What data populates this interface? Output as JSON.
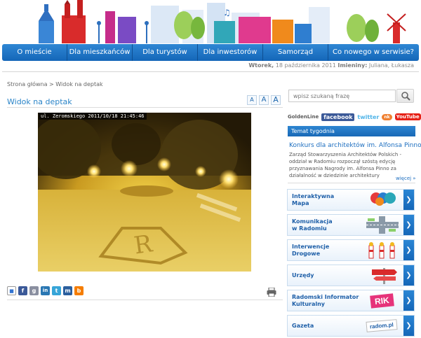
{
  "nav": {
    "items": [
      {
        "label": "O mieście"
      },
      {
        "label": "Dla mieszkańców"
      },
      {
        "label": "Dla turystów"
      },
      {
        "label": "Dla inwestorów"
      },
      {
        "label": "Samorząd"
      },
      {
        "label": "Co nowego w serwisie?"
      }
    ]
  },
  "dateline": {
    "day": "Wtorek,",
    "date": "18 października 2011",
    "names_label": "Imieniny:",
    "names": "Juliana, Łukasza"
  },
  "breadcrumb": {
    "home": "Strona główna",
    "separator": ">",
    "current": "Widok na deptak"
  },
  "page": {
    "title": "Widok na deptak"
  },
  "font_size_buttons": [
    "A",
    "A",
    "A"
  ],
  "webcam": {
    "stamp": "ul. Zeromskiego 2011/10/18 21:45:46"
  },
  "share_icons": [
    {
      "icon": "delicious-icon",
      "glyph": "■",
      "color": "#3274d1"
    },
    {
      "icon": "facebook-icon",
      "glyph": "f",
      "color": "#3b5998"
    },
    {
      "icon": "google-icon",
      "glyph": "g",
      "color": "#8a8fa0"
    },
    {
      "icon": "linkedin-icon",
      "glyph": "in",
      "color": "#2a77b3"
    },
    {
      "icon": "twitter-icon",
      "glyph": "t",
      "color": "#37a5d8"
    },
    {
      "icon": "myspace-icon",
      "glyph": "m",
      "color": "#2b5f9e"
    },
    {
      "icon": "blogger-icon",
      "glyph": "b",
      "color": "#f57d00"
    }
  ],
  "search": {
    "placeholder": "wpisz szukaną frazę"
  },
  "socials": {
    "golden": "GoldenLine",
    "facebook": "facebook",
    "twitter": "twitter",
    "other": "nk",
    "youtube": "YouTube"
  },
  "topic": {
    "header": "Temat tygodnia",
    "title": "Konkurs dla architektów im. Alfonsa Pinno",
    "text": "Zarząd Stowarzyszenia Architektów Polskich - oddział w Radomiu rozpoczął szóstą edycję przyznawania Nagrody im. Alfonsa Pinno za działalność w dziedzinie architektury",
    "more": "więcej »"
  },
  "promos": [
    {
      "line1": "Interaktywna",
      "line2": "Mapa"
    },
    {
      "line1": "Komunikacja",
      "line2": "w Radomiu"
    },
    {
      "line1": "Interwencje",
      "line2": "Drogowe"
    },
    {
      "line1": "Urzędy",
      "line2": ""
    },
    {
      "line1": "Radomski Informator",
      "line2": "Kulturalny"
    },
    {
      "line1": "Gazeta",
      "line2": ""
    }
  ],
  "promo_art": {
    "rik": "RIK",
    "gazeta": "radom.pl"
  },
  "colors": {
    "nav": "#1e74c4",
    "accent": "#2a84c8",
    "webcam_glow": "#e8c23a"
  }
}
